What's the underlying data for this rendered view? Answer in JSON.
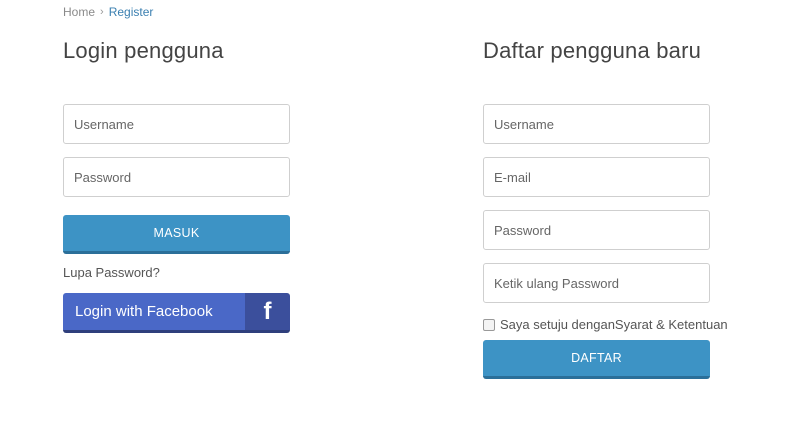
{
  "breadcrumb": {
    "home": "Home",
    "separator": "›",
    "current": "Register"
  },
  "login": {
    "title": "Login pengguna",
    "username_placeholder": "Username",
    "password_placeholder": "Password",
    "submit_label": "MASUK",
    "forgot_label": "Lupa Password?",
    "facebook_label": "Login with Facebook",
    "facebook_icon": "f"
  },
  "register": {
    "title": "Daftar pengguna baru",
    "username_placeholder": "Username",
    "email_placeholder": "E-mail",
    "password_placeholder": "Password",
    "repeat_password_placeholder": "Ketik ulang Password",
    "agree_label": "Saya setuju denganSyarat & Ketentuan",
    "submit_label": "DAFTAR"
  },
  "colors": {
    "primary_button": "#3d93c5",
    "facebook": "#4a68c7",
    "facebook_dark": "#3b4f9c"
  }
}
